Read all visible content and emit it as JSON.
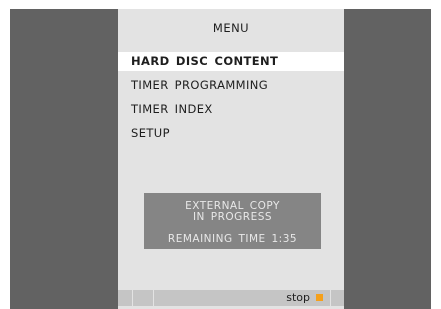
{
  "menu": {
    "title": "MENU",
    "items": [
      {
        "label": "HARD DISC CONTENT",
        "selected": true
      },
      {
        "label": "TIMER PROGRAMMING",
        "selected": false
      },
      {
        "label": "TIMER INDEX",
        "selected": false
      },
      {
        "label": "SETUP",
        "selected": false
      }
    ]
  },
  "dialog": {
    "line1": "EXTERNAL COPY",
    "line2": "IN PROGRESS",
    "line3": "REMAINING TIME 1:35"
  },
  "bottom_bar": {
    "stop_label": "stop",
    "stop_icon": "stop-square-icon",
    "stop_icon_color": "#f5a01a"
  },
  "colors": {
    "background": "#626262",
    "panel": "#e3e3e3",
    "dialog": "#858585",
    "selected_row": "#ffffff"
  }
}
